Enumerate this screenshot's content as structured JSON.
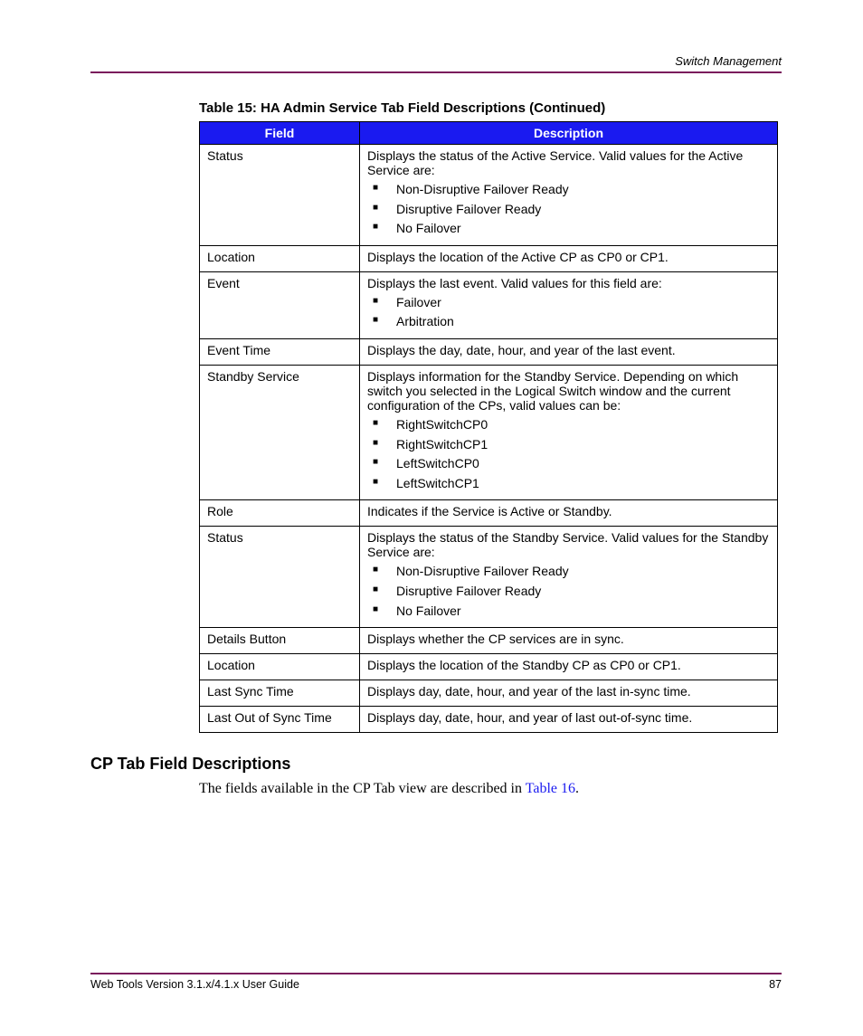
{
  "header": {
    "section": "Switch Management"
  },
  "table": {
    "caption": "Table 15:  HA Admin Service Tab Field Descriptions  (Continued)",
    "head": {
      "field": "Field",
      "description": "Description"
    },
    "rows": [
      {
        "field": "Status",
        "desc": "Displays the status of the Active Service. Valid values for the Active Service are:",
        "bullets": [
          "Non-Disruptive Failover Ready",
          "Disruptive Failover Ready",
          "No Failover"
        ]
      },
      {
        "field": "Location",
        "desc": "Displays the location of the Active CP as CP0 or CP1."
      },
      {
        "field": "Event",
        "desc": "Displays the last event. Valid values for this field are:",
        "bullets": [
          "Failover",
          "Arbitration"
        ]
      },
      {
        "field": "Event Time",
        "desc": "Displays the day, date, hour, and year of the last event."
      },
      {
        "field": "Standby Service",
        "desc": "Displays information for the Standby Service. Depending on which switch you selected in the Logical Switch window and the current configuration of the CPs, valid values can be:",
        "bullets": [
          "RightSwitchCP0",
          "RightSwitchCP1",
          "LeftSwitchCP0",
          "LeftSwitchCP1"
        ]
      },
      {
        "field": "Role",
        "desc": "Indicates if the Service is Active or Standby."
      },
      {
        "field": "Status",
        "desc": "Displays the status of the Standby Service. Valid values for the Standby Service are:",
        "bullets": [
          "Non-Disruptive Failover Ready",
          "Disruptive Failover Ready",
          "No Failover"
        ]
      },
      {
        "field": "Details Button",
        "desc": "Displays whether the CP services are in sync."
      },
      {
        "field": "Location",
        "desc": "Displays the location of the Standby CP as CP0 or CP1."
      },
      {
        "field": "Last Sync Time",
        "desc": "Displays day, date, hour, and year of the last in-sync time."
      },
      {
        "field": "Last Out of Sync Time",
        "desc": "Displays day, date, hour, and year of last out-of-sync time."
      }
    ]
  },
  "section": {
    "heading": "CP Tab Field Descriptions",
    "body_pre": "The fields available in the CP Tab view are described in ",
    "body_link": "Table 16",
    "body_post": "."
  },
  "footer": {
    "left": "Web Tools Version 3.1.x/4.1.x User Guide",
    "right": "87"
  }
}
